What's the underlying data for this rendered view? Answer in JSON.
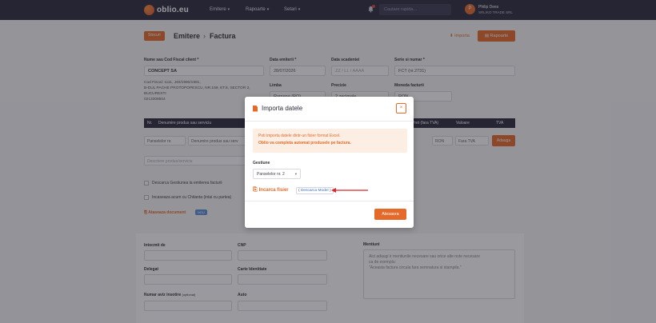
{
  "nav": {
    "logo_text": "oblio.eu",
    "items": [
      "Emitere",
      "Rapoarte",
      "Setari"
    ],
    "search_placeholder": "Cautare rapida...",
    "user_initial": "P",
    "user_name": "Philip Dees",
    "user_company": "SRL/KO TRADE SRL"
  },
  "header": {
    "badge": "Stocuri",
    "crumb1": "Emitere",
    "crumb2": "Factura",
    "importa_link": "Importa",
    "rapoarte_button": "Rapoarte"
  },
  "form": {
    "client_label": "Nume sau Cod Fiscal client *",
    "client_value": "CONCEPT SA",
    "client_info": [
      "Cod Fiscal: 1111, J40/1990/1991,",
      "B-DUL PACHE PROTOPOPESCU, NR.159, ET.8, SECTOR 2,",
      "BUCURESTI",
      "0213308504"
    ],
    "data_emiterii_label": "Data emiterii *",
    "data_emiterii_value": "28/07/2026",
    "data_scadentei_label": "Data scadentei",
    "data_scadentei_placeholder": "ZZ / LL / AAAA",
    "serie_label": "Serie si numar *",
    "serie_value": "FCT (nr.2731)",
    "limba_label": "Limba",
    "limba_value": "Romana (RO)",
    "precizie_label": "Precizie",
    "precizie_value": "2 zecimale",
    "moneda_label": "Moneda facturii",
    "moneda_value": "RON"
  },
  "table": {
    "headers": [
      "Nr.",
      "Denumire produs sau serviciu",
      "Pret (fara TVA)",
      "Valoare",
      "TVA"
    ],
    "row_gestiune": "Panselelor nr.",
    "row_denumire_ph": "Denumire produs sau serv",
    "row_moneda": "RON",
    "row_tva": "Fara TVA",
    "add_button": "Adauga",
    "desc_placeholder": "Descriere produs/serviciu"
  },
  "options": {
    "chk1": "Descarca Gestiunea la emiterea facturii",
    "chk2": "Incaseaza acum cu Chitanta (intai cu partea)",
    "attach": "Ataseaza document",
    "attach_badge": "NOU"
  },
  "bottom": {
    "intocmit": "Intocmit de",
    "cnp": "CNP",
    "delegat": "Delegat",
    "carte_id": "Carte Identitate",
    "numar_aviz": "Numar aviz insotire",
    "numar_aviz_small": "(optional)",
    "auto": "Auto",
    "mentiuni": "Mentiuni",
    "mentiuni_ph1": "Aici adaugi ir mentiunile necesare sau orice alte note necesare",
    "mentiuni_ph2": "ca de exemplu:",
    "mentiuni_ph3": "\"Aceasta factura circula fara semnatura si stampila.\""
  },
  "modal": {
    "title": "Importa datele",
    "close": "×",
    "alert_line1": "Poti importa datele dintr-un fisier format Excel.",
    "alert_line2": "Oblio va completa automat produsele pe factura.",
    "gestiune_label": "Gestiune",
    "gestiune_value": "Panselelor nr. 2",
    "upload_label": "Incarca fisier",
    "model_link": "Descarca Model",
    "alege_button": "Alesasra"
  },
  "colors": {
    "accent": "#e56a2a",
    "nav_bg": "#2a2a3c",
    "arrow": "#d9262c"
  }
}
